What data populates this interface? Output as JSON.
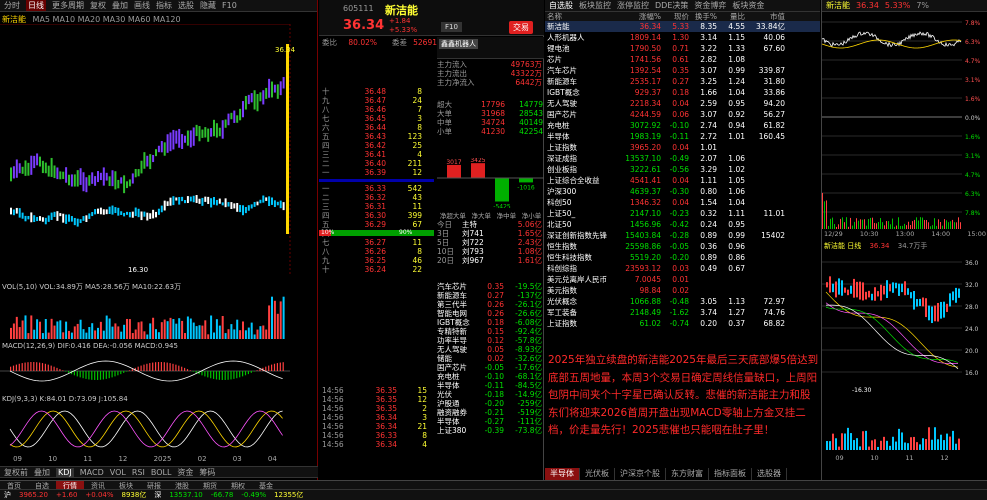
{
  "main_chart": {
    "toolbar": [
      "分时",
      "日线",
      "更多周期",
      "复权",
      "叠加",
      "画线",
      "指标",
      "选股",
      "隐藏",
      "F10"
    ],
    "title": "新洁能",
    "indicator_line": "MA5 MA10 MA20 MA30 MA60 MA120",
    "high_label": "36.34",
    "low_label": "16.30",
    "vol_label": "VOL(5,10) VOL:34.89万 MA5:28.56万 MA10:22.63万",
    "macd_label": "MACD(12,26,9) DIF:0.416 DEA:-0.056 MACD:0.945",
    "kdj_label": "KDJ(9,3,3) K:84.01 D:73.09 J:105.84",
    "date_labels": [
      "09",
      "10",
      "11",
      "12",
      "2025",
      "02",
      "03",
      "04"
    ],
    "bottom_tabs": [
      "复权前",
      "叠加",
      "KDJ",
      "MACD",
      "VOL",
      "RSI",
      "BOLL",
      "资金",
      "筹码"
    ]
  },
  "quote": {
    "code": "605111",
    "name": "新洁能",
    "price": "36.34",
    "change": "+1.84",
    "change_pct": "+5.33%",
    "btn_compare": "F10",
    "btn_trade": "交易",
    "wei": "委比",
    "wei_val": "80.02%",
    "wei_cha": "委差",
    "wei_cha_val": "52691",
    "asks": [
      {
        "label": "十",
        "price": "36.48",
        "vol": "8"
      },
      {
        "label": "九",
        "price": "36.47",
        "vol": "24"
      },
      {
        "label": "八",
        "price": "36.46",
        "vol": "7"
      },
      {
        "label": "七",
        "price": "36.45",
        "vol": "3"
      },
      {
        "label": "六",
        "price": "36.44",
        "vol": "8"
      },
      {
        "label": "五",
        "price": "36.43",
        "vol": "123"
      },
      {
        "label": "四",
        "price": "36.42",
        "vol": "25"
      },
      {
        "label": "三",
        "price": "36.41",
        "vol": "4"
      },
      {
        "label": "二",
        "price": "36.40",
        "vol": "211"
      },
      {
        "label": "一",
        "price": "36.39",
        "vol": "12"
      }
    ],
    "bids": [
      {
        "label": "一",
        "price": "36.33",
        "vol": "542"
      },
      {
        "label": "二",
        "price": "36.32",
        "vol": "43"
      },
      {
        "label": "三",
        "price": "36.31",
        "vol": "11"
      },
      {
        "label": "四",
        "price": "36.30",
        "vol": "399"
      },
      {
        "label": "五",
        "price": "36.29",
        "vol": "67"
      },
      {
        "label": "六",
        "price": "36.28",
        "vol": "5"
      },
      {
        "label": "七",
        "price": "36.27",
        "vol": "11"
      },
      {
        "label": "八",
        "price": "36.26",
        "vol": "8"
      },
      {
        "label": "九",
        "price": "36.25",
        "vol": "46"
      },
      {
        "label": "十",
        "price": "36.24",
        "vol": "22"
      }
    ],
    "sector": "鑫鑫机器人",
    "capital_labels": [
      "主力流入",
      "主力流出",
      "主力净流入"
    ],
    "capital_vals": [
      "49763万",
      "43322万",
      "6442万"
    ],
    "flow_rows": [
      {
        "name": "超大",
        "in": "17796",
        "out": "14779"
      },
      {
        "name": "大单",
        "in": "31968",
        "out": "28543"
      },
      {
        "name": "中单",
        "in": "34724",
        "out": "40149"
      },
      {
        "name": "小单",
        "in": "41230",
        "out": "42254"
      }
    ],
    "bars": [
      {
        "label": "3017",
        "v": 3017
      },
      {
        "label": "3425",
        "v": 3425
      },
      {
        "label": "-5425",
        "v": -5425
      },
      {
        "label": "-1016",
        "v": -1016
      }
    ],
    "net_tabs": [
      "净超大单",
      "净大单",
      "净中单",
      "净小单"
    ],
    "ratio_buy": "10%",
    "ratio_sell": "90%",
    "stats": [
      {
        "k": "今日",
        "v": "主特",
        "w": "5.06亿"
      },
      {
        "k": "3日",
        "v": "刘741",
        "w": "1.65亿"
      },
      {
        "k": "5日",
        "v": "刘722",
        "w": "2.43亿"
      },
      {
        "k": "10日",
        "v": "刘793",
        "w": "1.08亿"
      },
      {
        "k": "20日",
        "v": "刘967",
        "w": "1.61亿"
      }
    ],
    "concept_rows": [
      {
        "n": "汽车芯片",
        "a": "0.35",
        "b": "-19.5亿"
      },
      {
        "n": "新能源车",
        "a": "0.27",
        "b": "-137亿"
      },
      {
        "n": "第三代半",
        "a": "0.26",
        "b": "-26.1亿"
      },
      {
        "n": "智能电网",
        "a": "0.26",
        "b": "-26.6亿"
      },
      {
        "n": "IGBT概念",
        "a": "0.18",
        "b": "-6.08亿"
      },
      {
        "n": "专精特新",
        "a": "0.15",
        "b": "-92.4亿"
      },
      {
        "n": "功率半导",
        "a": "0.12",
        "b": "-57.8亿"
      },
      {
        "n": "无人驾驶",
        "a": "0.05",
        "b": "-8.93亿"
      },
      {
        "n": "储能",
        "a": "0.02",
        "b": "-32.6亿"
      },
      {
        "n": "国产芯片",
        "a": "-0.05",
        "b": "-17.6亿"
      },
      {
        "n": "充电桩",
        "a": "-0.10",
        "b": "-68.1亿"
      },
      {
        "n": "半导体",
        "a": "-0.11",
        "b": "-84.5亿"
      },
      {
        "n": "光伏",
        "a": "-0.18",
        "b": "-14.9亿"
      },
      {
        "n": "沪股通",
        "a": "-0.20",
        "b": "-259亿"
      },
      {
        "n": "融资融券",
        "a": "-0.21",
        "b": "-519亿"
      },
      {
        "n": "半导体",
        "a": "-0.27",
        "b": "-111亿"
      },
      {
        "n": "上证380",
        "a": "-0.39",
        "b": "-73.8亿"
      }
    ],
    "ticks": [
      {
        "t": "14:56",
        "p": "36.35",
        "v": "15"
      },
      {
        "t": "14:56",
        "p": "36.35",
        "v": "12"
      },
      {
        "t": "14:56",
        "p": "36.35",
        "v": "2"
      },
      {
        "t": "14:56",
        "p": "36.34",
        "v": "3"
      },
      {
        "t": "14:56",
        "p": "36.34",
        "v": "21"
      },
      {
        "t": "14:56",
        "p": "36.33",
        "v": "8"
      },
      {
        "t": "14:56",
        "p": "36.34",
        "v": "4"
      }
    ]
  },
  "board": {
    "headers": [
      "名称",
      "涨幅%",
      "现价",
      "换手%",
      "量比",
      "市值"
    ],
    "top_tabs": [
      "自选股",
      "板块监控",
      "涨停监控",
      "DDE决策",
      "资金博弈",
      "板块资金"
    ],
    "rows": [
      {
        "n": "新洁能",
        "z": "36.34",
        "a": "5.33",
        "b": "8.35",
        "c": "4.55",
        "d": "33.84亿",
        "hl": true
      },
      {
        "n": "人形机器人",
        "z": "1809.14",
        "a": "1.30",
        "b": "3.14",
        "c": "1.15",
        "d": "40.06"
      },
      {
        "n": "锂电池",
        "z": "1790.50",
        "a": "0.71",
        "b": "3.22",
        "c": "1.33",
        "d": "67.60"
      },
      {
        "n": "芯片",
        "z": "1741.56",
        "a": "0.61",
        "b": "2.82",
        "c": "1.08",
        "d": ""
      },
      {
        "n": "汽车芯片",
        "z": "1392.54",
        "a": "0.35",
        "b": "3.07",
        "c": "0.99",
        "d": "339.87"
      },
      {
        "n": "新能源车",
        "z": "2535.17",
        "a": "0.27",
        "b": "3.25",
        "c": "1.24",
        "d": "31.80"
      },
      {
        "n": "IGBT概念",
        "z": "929.37",
        "a": "0.18",
        "b": "1.66",
        "c": "1.04",
        "d": "33.86"
      },
      {
        "n": "无人驾驶",
        "z": "2218.34",
        "a": "0.04",
        "b": "2.59",
        "c": "0.95",
        "d": "94.20"
      },
      {
        "n": "国产芯片",
        "z": "4244.59",
        "a": "0.06",
        "b": "3.07",
        "c": "0.92",
        "d": "56.27"
      },
      {
        "n": "充电桩",
        "z": "3072.92",
        "a": "-0.10",
        "b": "2.74",
        "c": "0.94",
        "d": "61.82"
      },
      {
        "n": "半导体",
        "z": "1983.19",
        "a": "-0.11",
        "b": "2.72",
        "c": "1.01",
        "d": "160.45"
      },
      {
        "n": "上证指数",
        "z": "3965.20",
        "a": "0.04",
        "b": "1.01",
        "c": "",
        "d": ""
      },
      {
        "n": "深证成指",
        "z": "13537.10",
        "a": "-0.49",
        "b": "2.07",
        "c": "1.06",
        "d": ""
      },
      {
        "n": "创业板指",
        "z": "3222.61",
        "a": "-0.56",
        "b": "3.29",
        "c": "1.02",
        "d": ""
      },
      {
        "n": "上证综合全收益",
        "z": "4541.41",
        "a": "0.04",
        "b": "1.11",
        "c": "1.05",
        "d": ""
      },
      {
        "n": "沪深300",
        "z": "4639.37",
        "a": "-0.30",
        "b": "0.80",
        "c": "1.06",
        "d": ""
      },
      {
        "n": "科创50",
        "z": "1346.32",
        "a": "0.04",
        "b": "1.54",
        "c": "1.04",
        "d": ""
      },
      {
        "n": "上证50_",
        "z": "2147.10",
        "a": "-0.23",
        "b": "0.32",
        "c": "1.11",
        "d": "11.01"
      },
      {
        "n": "北证50",
        "z": "1456.96",
        "a": "-0.42",
        "b": "0.24",
        "c": "0.95",
        "d": ""
      },
      {
        "n": "深证创新指数先锋",
        "z": "15403.84",
        "a": "-0.28",
        "b": "0.89",
        "c": "0.99",
        "d": "15402"
      },
      {
        "n": "恒生指数",
        "z": "25598.86",
        "a": "-0.05",
        "b": "0.36",
        "c": "0.96",
        "d": ""
      },
      {
        "n": "恒生科技指数",
        "z": "5519.20",
        "a": "-0.20",
        "b": "0.89",
        "c": "0.86",
        "d": ""
      },
      {
        "n": "科创综指",
        "z": "23593.12",
        "a": "0.03",
        "b": "0.49",
        "c": "0.67",
        "d": ""
      },
      {
        "n": "美元兑离岸人民币",
        "z": "7.0045",
        "a": "0.01",
        "b": "",
        "c": "",
        "d": ""
      },
      {
        "n": "美元指数",
        "z": "98.84",
        "a": "0.02",
        "b": "",
        "c": "",
        "d": ""
      },
      {
        "n": "光伏概念",
        "z": "1066.88",
        "a": "-0.48",
        "b": "3.05",
        "c": "1.13",
        "d": "72.97"
      },
      {
        "n": "军工装备",
        "z": "2148.49",
        "a": "-1.62",
        "b": "3.74",
        "c": "1.27",
        "d": "74.76"
      },
      {
        "n": "上证指数",
        "z": "61.02",
        "a": "-0.74",
        "b": "0.20",
        "c": "0.37",
        "d": "68.82"
      }
    ]
  },
  "annotation": "2025年独立续盘的新洁能2025年最后三天底部爆5倍达到底部五周地量，本周3个交易日确定周线信量缺口，上周阳包阴中间夹个十字星已确认反转。悲催的新洁能主力和股东们将迎来2026首周开盘出现MACD零轴上方金叉挂二档，价走量先行！2025悲催也只能咽在肚子里！",
  "mini": {
    "header_name": "新洁能",
    "header_price": "36.34",
    "header_pct": "5.33%",
    "header_vol": "7%",
    "pct_axis": [
      "7.8%",
      "6.3%",
      "4.7%",
      "3.1%",
      "1.6%",
      "0.0%",
      "1.6%",
      "3.1%",
      "4.7%",
      "6.3%",
      "7.8%"
    ],
    "time_axis": [
      "12/29",
      "10:30",
      "13:00",
      "14:00",
      "15:00"
    ],
    "chart2_label": "新洁能 日线",
    "chart2_price": "36.34",
    "chart2_vol": "34.7万手",
    "chart2_low": "-16.30",
    "chart2_axis": [
      "36.0",
      "32.0",
      "28.0",
      "24.0",
      "20.0",
      "16.0"
    ],
    "chart2_dates": [
      "09",
      "10",
      "11",
      "12"
    ]
  },
  "bottom_bar": {
    "tabs": [
      "首页",
      "自选",
      "行情",
      "资讯",
      "板块",
      "研报",
      "港股",
      "期货",
      "期权",
      "基金"
    ],
    "index1_name": "沪",
    "index1_val": "3965.20",
    "index1_chg": "+1.60",
    "index1_pct": "+0.04%",
    "index1_amt": "8938亿",
    "index2_name": "深",
    "index2_val": "13537.10",
    "index2_chg": "-66.78",
    "index2_pct": "-0.49%",
    "index2_amt": "12355亿",
    "right_tabs": [
      "半导体",
      "光伏板",
      "沪深京个股",
      "东方财富",
      "指标面板",
      "选股器"
    ]
  }
}
